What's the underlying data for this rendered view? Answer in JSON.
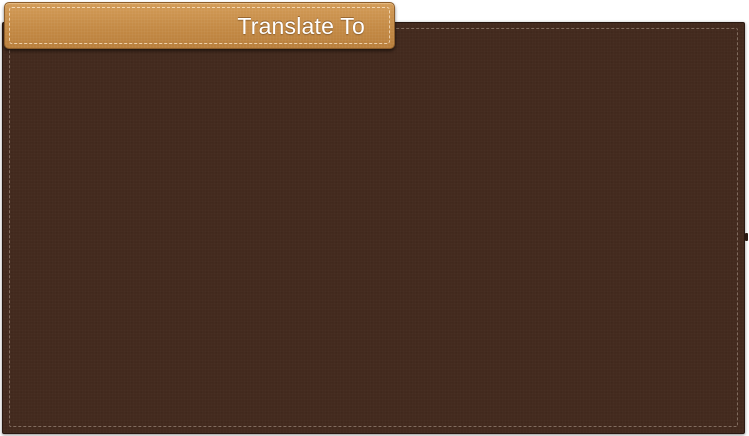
{
  "tab": {
    "title": "Translate To"
  },
  "colors": {
    "panel_background": "#432a1e",
    "tab_background": "#c48a45",
    "stitching": "#b2a094",
    "title_text": "#ffffff"
  }
}
